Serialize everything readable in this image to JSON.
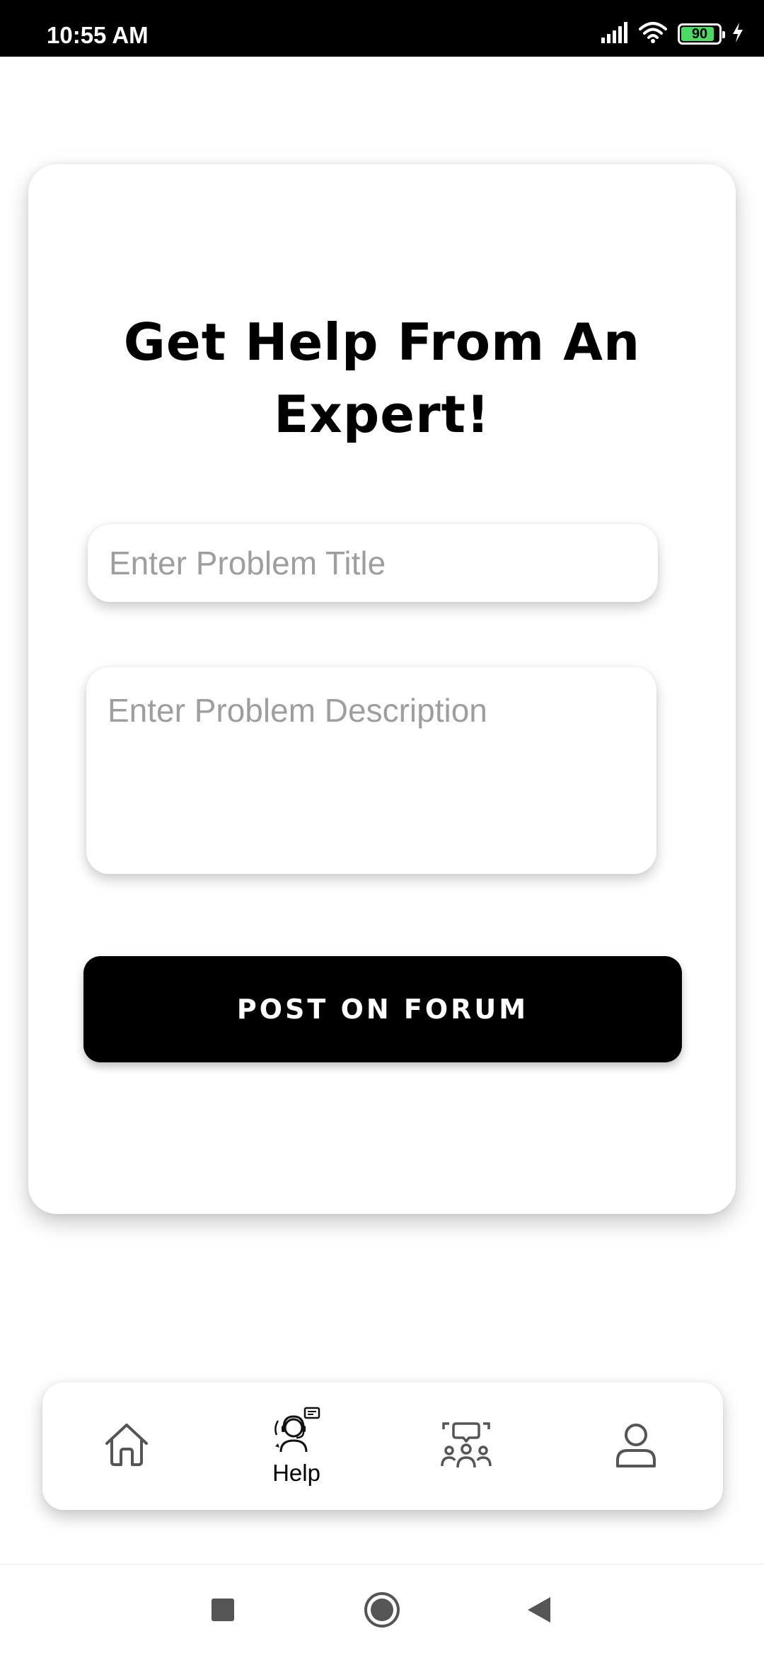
{
  "status_bar": {
    "time": "10:55 AM",
    "battery_level": "90",
    "battery_fraction": 0.9,
    "icons": [
      "signal-icon",
      "wifi-icon",
      "battery-icon",
      "charging-icon"
    ]
  },
  "card": {
    "title": "Get Help From An Expert!",
    "title_input": {
      "value": "",
      "placeholder": "Enter Problem Title"
    },
    "description_input": {
      "value": "",
      "placeholder": "Enter Problem Description"
    },
    "post_button": "POST ON FORUM"
  },
  "bottom_nav": {
    "items": [
      {
        "icon": "home-icon",
        "label": ""
      },
      {
        "icon": "help-support-icon",
        "label": "Help",
        "active": true
      },
      {
        "icon": "forum-community-icon",
        "label": ""
      },
      {
        "icon": "profile-icon",
        "label": ""
      }
    ]
  },
  "system_nav": {
    "buttons": [
      "recents-button",
      "home-button",
      "back-button"
    ]
  },
  "colors": {
    "background": "#ffffff",
    "primary": "#000000",
    "placeholder": "#9e9e9e",
    "battery_fill": "#4cd964"
  }
}
